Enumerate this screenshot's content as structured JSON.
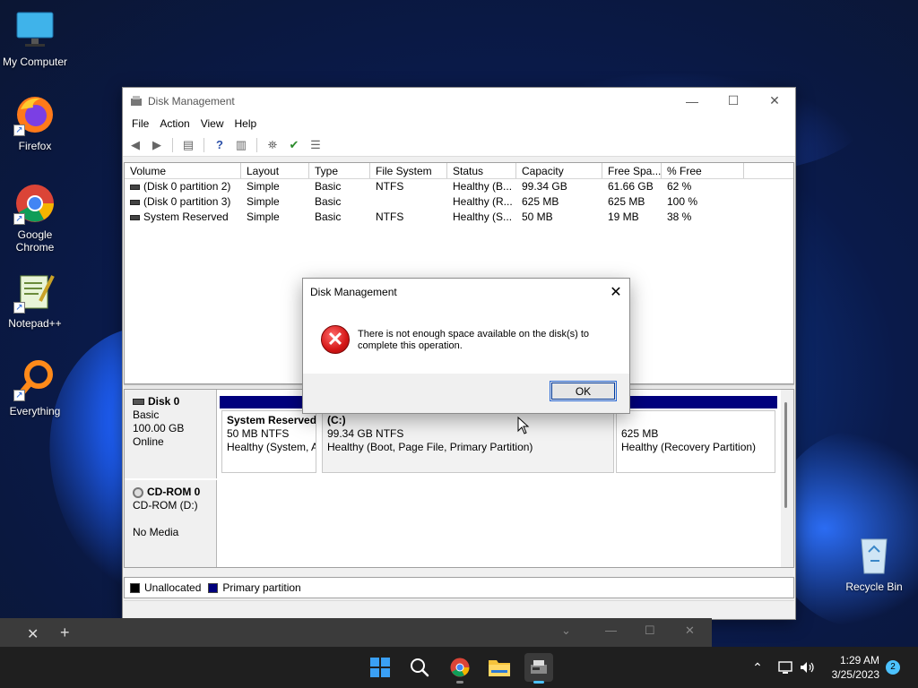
{
  "desktop": {
    "icons": [
      {
        "label": "My Computer"
      },
      {
        "label": "Firefox"
      },
      {
        "label": "Google Chrome"
      },
      {
        "label": "Notepad++"
      },
      {
        "label": "Everything"
      },
      {
        "label": "Recycle Bin"
      }
    ]
  },
  "window": {
    "title": "Disk Management",
    "menu": [
      "File",
      "Action",
      "View",
      "Help"
    ],
    "columns": [
      "Volume",
      "Layout",
      "Type",
      "File System",
      "Status",
      "Capacity",
      "Free Spa...",
      "% Free"
    ],
    "volumes": [
      {
        "volume": "(Disk 0 partition 2)",
        "layout": "Simple",
        "type": "Basic",
        "fs": "NTFS",
        "status": "Healthy (B...",
        "capacity": "99.34 GB",
        "free": "61.66 GB",
        "pct": "62 %"
      },
      {
        "volume": "(Disk 0 partition 3)",
        "layout": "Simple",
        "type": "Basic",
        "fs": "",
        "status": "Healthy (R...",
        "capacity": "625 MB",
        "free": "625 MB",
        "pct": "100 %"
      },
      {
        "volume": "System Reserved",
        "layout": "Simple",
        "type": "Basic",
        "fs": "NTFS",
        "status": "Healthy (S...",
        "capacity": "50 MB",
        "free": "19 MB",
        "pct": "38 %"
      }
    ],
    "disks": [
      {
        "name": "Disk 0",
        "kind": "Basic",
        "size": "100.00 GB",
        "state": "Online",
        "partitions": [
          {
            "name": "System Reserved",
            "size": "50 MB NTFS",
            "status": "Healthy (System, Active, Primary Partition)"
          },
          {
            "name": "(C:)",
            "size": "99.34 GB NTFS",
            "status": "Healthy (Boot, Page File, Primary Partition)"
          },
          {
            "name": "",
            "size": "625 MB",
            "status": "Healthy (Recovery Partition)"
          }
        ]
      },
      {
        "name": "CD-ROM 0",
        "kind": "CD-ROM (D:)",
        "size": "",
        "state": "No Media"
      }
    ],
    "legend": {
      "unallocated": "Unallocated",
      "primary": "Primary partition",
      "unallocated_color": "#000000",
      "primary_color": "#00007d"
    }
  },
  "dialog": {
    "title": "Disk Management",
    "message": "There is not enough space available on the disk(s) to complete this operation.",
    "ok_label": "OK",
    "icon": "error-icon"
  },
  "taskbar": {
    "apps": [
      "start-icon",
      "search-icon",
      "chrome-icon",
      "file-explorer-icon",
      "disk-management-icon"
    ],
    "time": "1:29 AM",
    "date": "3/25/2023",
    "notification_count": "2"
  }
}
